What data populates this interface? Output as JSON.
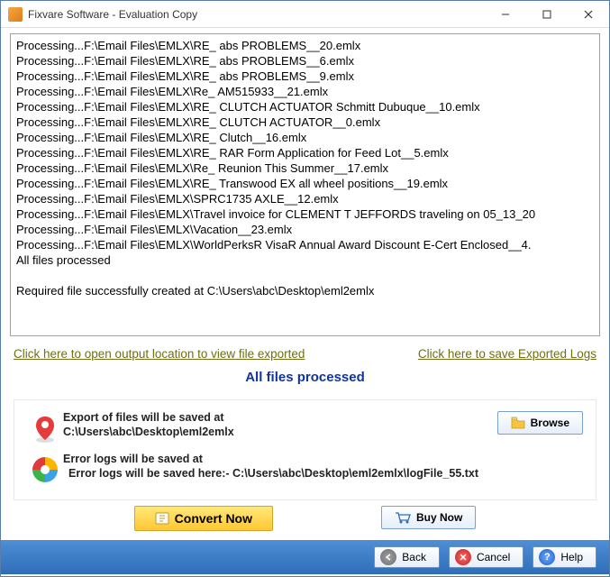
{
  "window": {
    "title": "Fixvare Software - Evaluation Copy"
  },
  "log": {
    "lines": [
      "Processing...F:\\Email Files\\EMLX\\RE_ abs PROBLEMS__20.emlx",
      "Processing...F:\\Email Files\\EMLX\\RE_ abs PROBLEMS__6.emlx",
      "Processing...F:\\Email Files\\EMLX\\RE_ abs PROBLEMS__9.emlx",
      "Processing...F:\\Email Files\\EMLX\\Re_ AM515933__21.emlx",
      "Processing...F:\\Email Files\\EMLX\\RE_ CLUTCH ACTUATOR Schmitt Dubuque__10.emlx",
      "Processing...F:\\Email Files\\EMLX\\RE_ CLUTCH ACTUATOR__0.emlx",
      "Processing...F:\\Email Files\\EMLX\\RE_ Clutch__16.emlx",
      "Processing...F:\\Email Files\\EMLX\\RE_ RAR Form Application for Feed Lot__5.emlx",
      "Processing...F:\\Email Files\\EMLX\\Re_ Reunion This Summer__17.emlx",
      "Processing...F:\\Email Files\\EMLX\\RE_ Transwood EX all wheel positions__19.emlx",
      "Processing...F:\\Email Files\\EMLX\\SPRC1735 AXLE__12.emlx",
      "Processing...F:\\Email Files\\EMLX\\Travel invoice for CLEMENT T JEFFORDS traveling on 05_13_20",
      "Processing...F:\\Email Files\\EMLX\\Vacation__23.emlx",
      "Processing...F:\\Email Files\\EMLX\\WorldPerksR VisaR Annual Award Discount E-Cert Enclosed__4.",
      "All files processed",
      "",
      "Required file successfully created at C:\\Users\\abc\\Desktop\\eml2emlx"
    ]
  },
  "links": {
    "open_output": "Click here to open output location to view file exported",
    "save_logs": "Click here to save Exported Logs"
  },
  "status": {
    "processed": "All files processed"
  },
  "export": {
    "heading": "Export of files will be saved at",
    "path": "C:\\Users\\abc\\Desktop\\eml2emlx",
    "browse_label": "Browse"
  },
  "errorlog": {
    "heading": "Error logs will be saved at",
    "detail": "Error logs will be saved here:- C:\\Users\\abc\\Desktop\\eml2emlx\\logFile_55.txt"
  },
  "actions": {
    "convert": "Convert Now",
    "buy": "Buy Now"
  },
  "footer": {
    "back": "Back",
    "cancel": "Cancel",
    "help": "Help"
  }
}
